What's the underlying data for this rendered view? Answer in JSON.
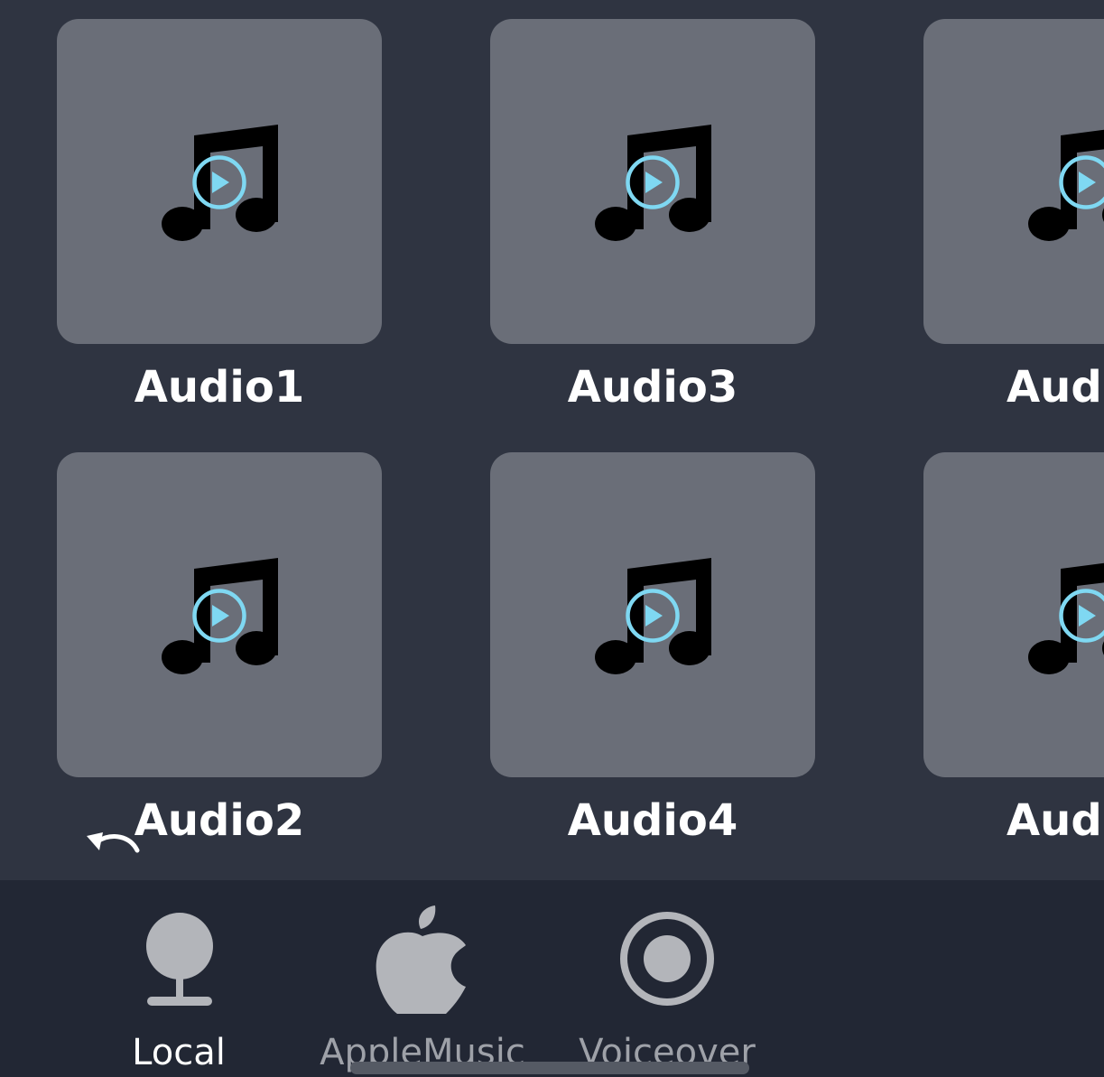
{
  "tiles": [
    {
      "label": "Audio1",
      "icon": "music-note-icon",
      "overlay": "play-circle-icon"
    },
    {
      "label": "Audio3",
      "icon": "music-note-icon",
      "overlay": "play-circle-icon"
    },
    {
      "label": "Audi",
      "icon": "music-note-icon",
      "overlay": "play-circle-icon"
    },
    {
      "label": "Audio2",
      "icon": "music-note-icon",
      "overlay": "play-circle-icon"
    },
    {
      "label": "Audio4",
      "icon": "music-note-icon",
      "overlay": "play-circle-icon"
    },
    {
      "label": "Audi",
      "icon": "music-note-icon",
      "overlay": "play-circle-icon"
    }
  ],
  "tabbar": {
    "tabs": [
      {
        "label": "Local",
        "icon": "local-icon",
        "active": true
      },
      {
        "label": "AppleMusic",
        "icon": "apple-icon",
        "active": false
      },
      {
        "label": "Voiceover",
        "icon": "record-icon",
        "active": false
      }
    ]
  },
  "colors": {
    "background": "#2f3441",
    "tile": "#6a6e78",
    "play_accent": "#7fd8f2",
    "tabbar": "#222734"
  }
}
